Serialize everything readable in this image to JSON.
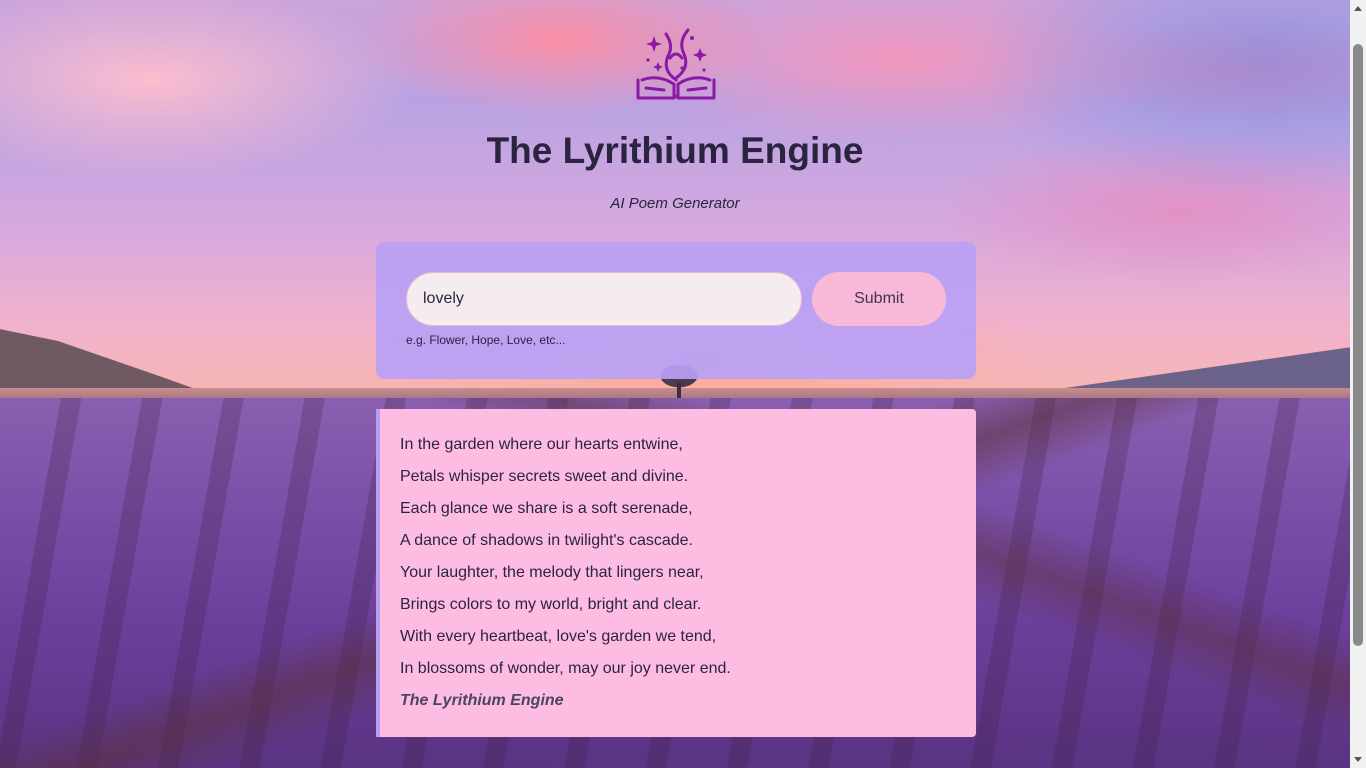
{
  "header": {
    "logo_icon": "poem-book-magic-icon",
    "title": "The Lyrithium Engine",
    "subtitle": "AI Poem Generator"
  },
  "form": {
    "input_value": "lovely",
    "submit_label": "Submit",
    "hint": "e.g. Flower, Hope, Love, etc..."
  },
  "poem": {
    "lines": [
      "In the garden where our hearts entwine,",
      "Petals whisper secrets sweet and divine.",
      "Each glance we share is a soft serenade,",
      "A dance of shadows in twilight's cascade.",
      "Your laughter, the melody that lingers near,",
      "Brings colors to my world, bright and clear.",
      "With every heartbeat, love's garden we tend,",
      "In blossoms of wonder, may our joy never end."
    ],
    "signature": "The Lyrithium Engine"
  },
  "colors": {
    "form_card": "#b9a0f5",
    "poem_card": "#fdbde2",
    "accent_border": "#b79cf0",
    "submit_button": "#f8b8d7",
    "text": "#2a2441",
    "logo": "#8a1aa6"
  }
}
